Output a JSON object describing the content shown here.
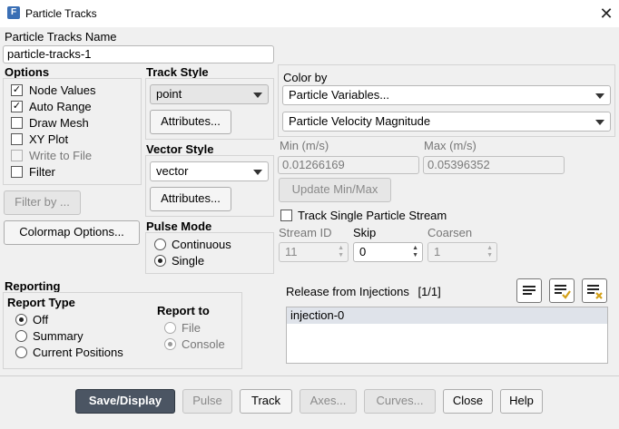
{
  "window": {
    "title": "Particle Tracks",
    "app_icon": "F"
  },
  "name": {
    "label": "Particle Tracks Name",
    "value": "particle-tracks-1"
  },
  "options": {
    "label": "Options",
    "items": [
      {
        "label": "Node Values",
        "checked": true,
        "enabled": true
      },
      {
        "label": "Auto Range",
        "checked": true,
        "enabled": true
      },
      {
        "label": "Draw Mesh",
        "checked": false,
        "enabled": true
      },
      {
        "label": "XY Plot",
        "checked": false,
        "enabled": true
      },
      {
        "label": "Write to File",
        "checked": false,
        "enabled": false
      },
      {
        "label": "Filter",
        "checked": false,
        "enabled": true
      }
    ],
    "filter_by_label": "Filter by ...",
    "colormap_label": "Colormap Options..."
  },
  "track_style": {
    "label": "Track Style",
    "value": "point",
    "attributes_label": "Attributes..."
  },
  "vector_style": {
    "label": "Vector Style",
    "value": "vector",
    "attributes_label": "Attributes..."
  },
  "pulse_mode": {
    "label": "Pulse Mode",
    "options": [
      "Continuous",
      "Single"
    ],
    "selected": "Single"
  },
  "color_by": {
    "label": "Color by",
    "category": "Particle Variables...",
    "variable": "Particle Velocity Magnitude",
    "min_label": "Min (m/s)",
    "min_value": "0.01266169",
    "max_label": "Max (m/s)",
    "max_value": "0.05396352",
    "update_label": "Update Min/Max"
  },
  "single_stream": {
    "label": "Track Single Particle Stream",
    "checked": false,
    "stream_id_label": "Stream ID",
    "stream_id_value": "11",
    "skip_label": "Skip",
    "skip_value": "0",
    "coarsen_label": "Coarsen",
    "coarsen_value": "1"
  },
  "reporting": {
    "label": "Reporting",
    "type_label": "Report Type",
    "types": [
      "Off",
      "Summary",
      "Current Positions"
    ],
    "type_selected": "Off",
    "to_label": "Report to",
    "targets": [
      "File",
      "Console"
    ],
    "target_selected": "Console"
  },
  "injections": {
    "label": "Release from Injections",
    "count": "[1/1]",
    "items": [
      "injection-0"
    ]
  },
  "buttons": {
    "save_display": "Save/Display",
    "pulse": "Pulse",
    "track": "Track",
    "axes": "Axes...",
    "curves": "Curves...",
    "close": "Close",
    "help": "Help"
  }
}
